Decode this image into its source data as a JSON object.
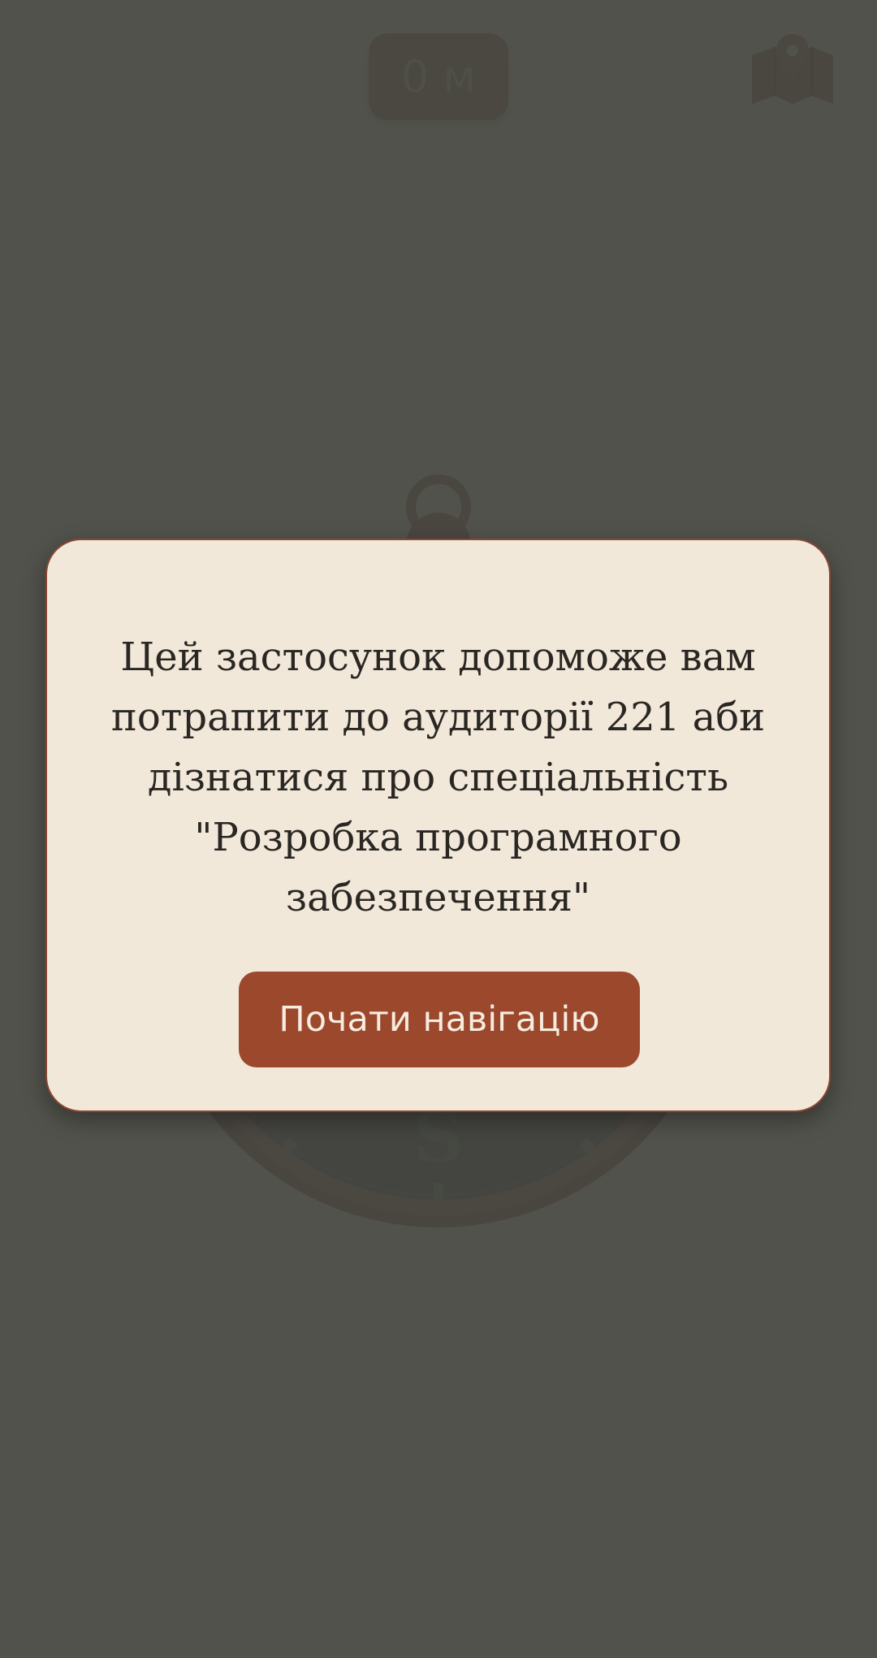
{
  "status": {
    "distance_label": "0 м"
  },
  "toolbar": {
    "map_icon": "map-pin-icon"
  },
  "compass": {
    "south_label": "S"
  },
  "dialog": {
    "message": "Цей застосунок допоможе вам потрапити до аудиторії 221 аби дізнатися про спеціальність \"Розробка програмного забезпечення\"",
    "button_label": "Почати навігацію"
  },
  "colors": {
    "accent": "#9c482d",
    "dialog_background": "#f1e8da",
    "overlay": "#464742"
  }
}
